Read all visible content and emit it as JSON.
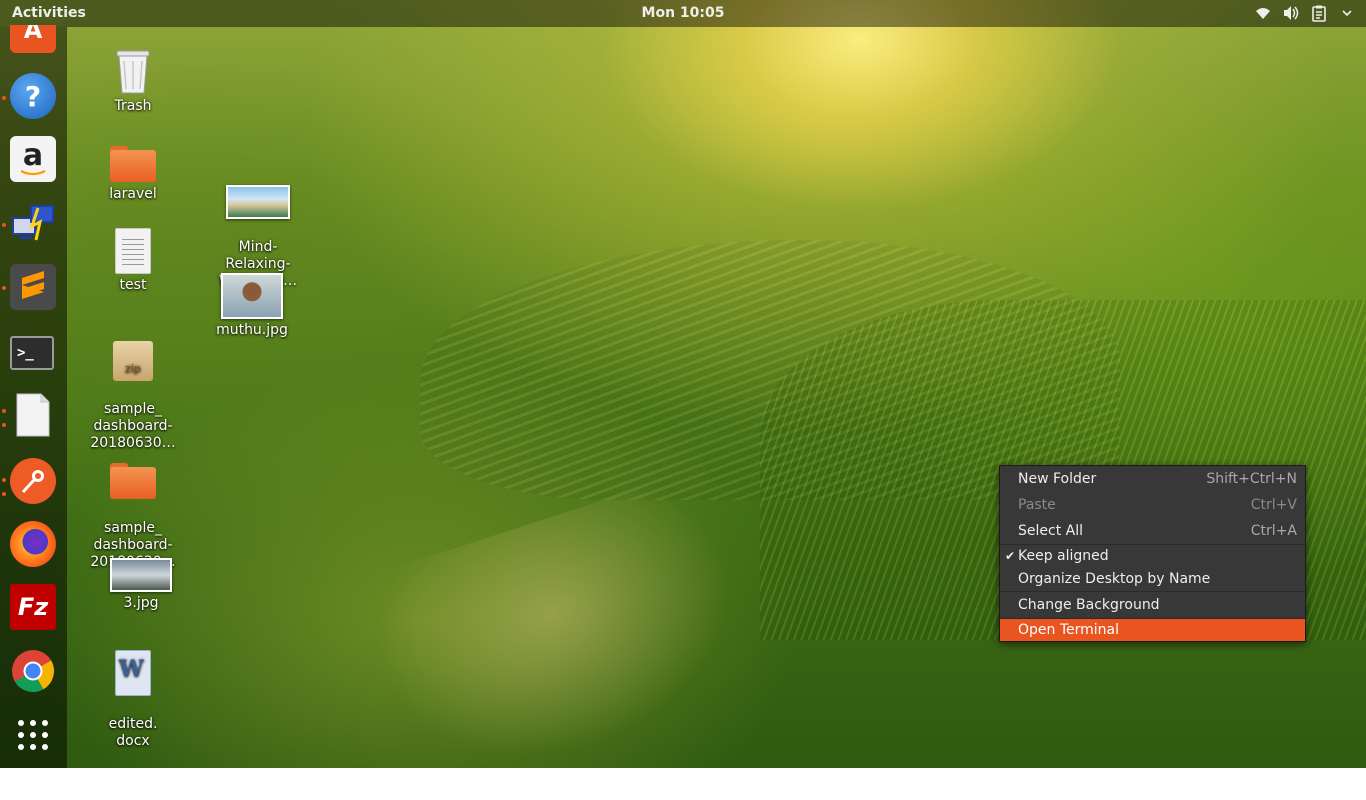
{
  "topbar": {
    "activities": "Activities",
    "clock": "Mon 10:05",
    "tray_icons": [
      "wifi-icon",
      "volume-icon",
      "clipboard-icon",
      "system-menu-arrow-icon"
    ]
  },
  "dock": {
    "apps": [
      {
        "name": "software-center",
        "glyph": "A",
        "color": "#e95420",
        "running": false
      },
      {
        "name": "help",
        "glyph": "?",
        "color": "#2a7fd4",
        "running": true
      },
      {
        "name": "amazon",
        "glyph": "a",
        "color": "#f0f0f0",
        "running": false
      },
      {
        "name": "remote-desktop",
        "glyph": "⚡",
        "color": "#1e3ea0",
        "running": true
      },
      {
        "name": "sublime-text",
        "glyph": "S",
        "color": "#ff9800",
        "running": true
      },
      {
        "name": "terminal",
        "glyph": ">_",
        "color": "#2d2d2d",
        "running": false
      },
      {
        "name": "text-editor",
        "glyph": "",
        "color": "#f2f2f2",
        "running": true
      },
      {
        "name": "postman",
        "glyph": "✎",
        "color": "#ef5b25",
        "running": true
      },
      {
        "name": "firefox",
        "glyph": "",
        "color": "#ff7a1a",
        "running": false
      },
      {
        "name": "filezilla",
        "glyph": "Fz",
        "color": "#bf0000",
        "running": false
      },
      {
        "name": "chrome",
        "glyph": "",
        "color": "#4285f4",
        "running": false
      },
      {
        "name": "show-applications",
        "glyph": "",
        "color": "transparent",
        "running": false
      }
    ]
  },
  "desktop": {
    "icons": [
      {
        "label": "Trash",
        "type": "trash"
      },
      {
        "label": "laravel",
        "type": "folder"
      },
      {
        "label": "test",
        "type": "text"
      },
      {
        "label": "sample_\ndashboard-\n20180630…",
        "type": "zip"
      },
      {
        "label": "sample_\ndashboard-\n20180630…",
        "type": "folder"
      },
      {
        "label": "3.jpg",
        "type": "image"
      },
      {
        "label": "edited.\ndocx",
        "type": "docx"
      },
      {
        "label": "Mind-\nRelaxing-\nWallpape…",
        "type": "image"
      },
      {
        "label": "muthu.jpg",
        "type": "image"
      }
    ]
  },
  "context_menu": {
    "items": [
      {
        "label": "New Folder",
        "accel": "Shift+Ctrl+N",
        "enabled": true
      },
      {
        "label": "Paste",
        "accel": "Ctrl+V",
        "enabled": false
      },
      {
        "label": "Select All",
        "accel": "Ctrl+A",
        "enabled": true
      },
      {
        "label": "Keep aligned",
        "checked": true,
        "enabled": true
      },
      {
        "label": "Organize Desktop by Name",
        "enabled": true
      },
      {
        "label": "Change Background",
        "enabled": true
      },
      {
        "label": "Open Terminal",
        "enabled": true,
        "highlighted": true
      }
    ],
    "highlight_color": "#e95420"
  }
}
